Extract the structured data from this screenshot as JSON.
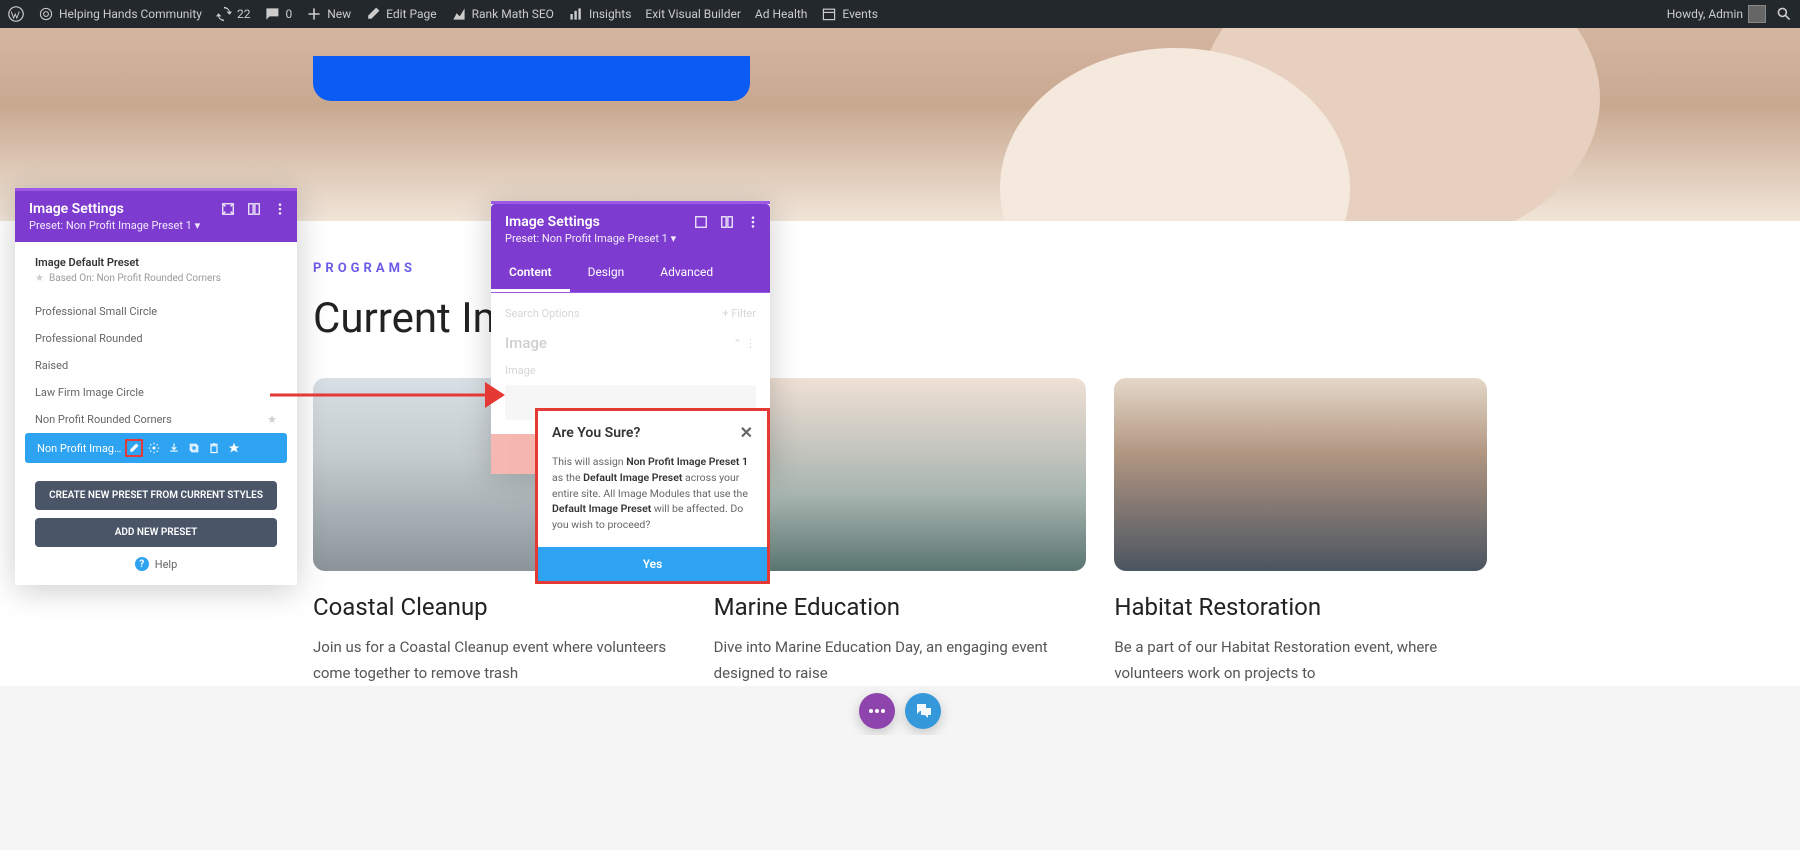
{
  "adminBar": {
    "siteName": "Helping Hands Community",
    "updates": "22",
    "comments": "0",
    "new": "New",
    "editPage": "Edit Page",
    "rankMath": "Rank Math SEO",
    "insights": "Insights",
    "exitVB": "Exit Visual Builder",
    "adHealth": "Ad Health",
    "events": "Events",
    "howdy": "Howdy, Admin"
  },
  "content": {
    "programsLabel": "PROGRAMS",
    "pageTitle": "Current Impact Projects",
    "cards": [
      {
        "title": "Coastal Cleanup",
        "text": "Join us for a Coastal Cleanup event where volunteers come together to remove trash"
      },
      {
        "title": "Marine Education",
        "text": "Dive into Marine Education Day, an engaging event designed to raise"
      },
      {
        "title": "Habitat Restoration",
        "text": "Be a part of our Habitat Restoration event, where volunteers work on projects to"
      }
    ]
  },
  "panel1": {
    "title": "Image Settings",
    "presetLine": "Preset: Non Profit Image Preset 1 ▾",
    "defaultLabel": "Image Default Preset",
    "basedOn": "Based On: Non Profit Rounded Corners",
    "presets": [
      "Professional Small Circle",
      "Professional Rounded",
      "Raised",
      "Law Firm Image Circle",
      "Non Profit Rounded Corners"
    ],
    "activePreset": "Non Profit Image P...",
    "createBtn": "CREATE NEW PRESET FROM CURRENT STYLES",
    "addBtn": "ADD NEW PRESET",
    "help": "Help"
  },
  "panel2": {
    "title": "Image Settings",
    "presetLine": "Preset: Non Profit Image Preset 1 ▾",
    "tabs": {
      "content": "Content",
      "design": "Design",
      "advanced": "Advanced"
    },
    "searchPlaceholder": "Search Options",
    "filter": "Filter",
    "imageSection": "Image",
    "imageLabel": "Image"
  },
  "confirm": {
    "title": "Are You Sure?",
    "pre": "This will assign ",
    "b1": "Non Profit Image Preset 1",
    "mid1": " as the ",
    "b2": "Default Image Preset",
    "mid2": " across your entire site. All Image Modules that use the ",
    "b3": "Default Image Preset",
    "post": " will be affected. Do you wish to proceed?",
    "yes": "Yes"
  }
}
